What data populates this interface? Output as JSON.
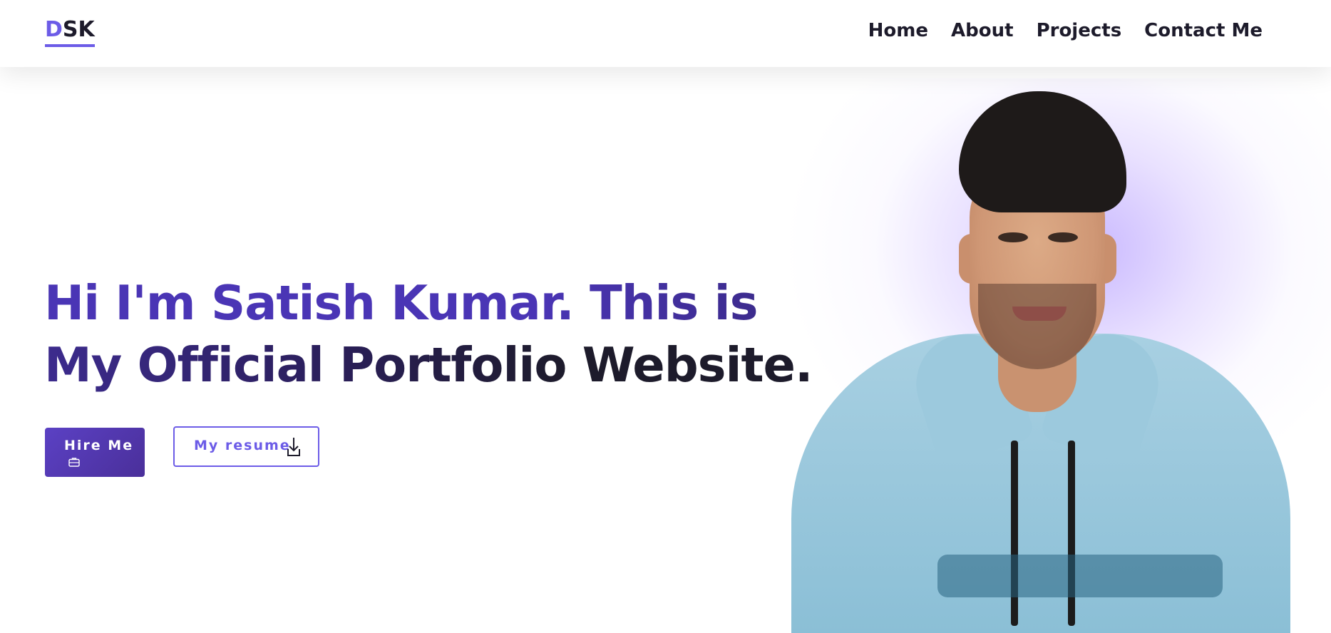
{
  "brand": {
    "logo_accent": "D",
    "logo_rest": "SK"
  },
  "nav": {
    "links": [
      {
        "label": "Home"
      },
      {
        "label": "About"
      },
      {
        "label": "Projects"
      },
      {
        "label": "Contact Me"
      }
    ]
  },
  "hero": {
    "headline_part1": "Hi I'm Satish Kumar. This is My Official Portfolio",
    "headline_part2": " Website.",
    "hire_button": {
      "label": "Hire Me",
      "icon": "briefcase-icon"
    },
    "resume_button": {
      "label": "My resume",
      "icon": "download-icon"
    },
    "portrait_image": "portrait-photo"
  },
  "colors": {
    "accent": "#6c5ce7",
    "accent_dark": "#4a35b5",
    "text_dark": "#1d1b2b",
    "glow": "#c9b8ff"
  }
}
